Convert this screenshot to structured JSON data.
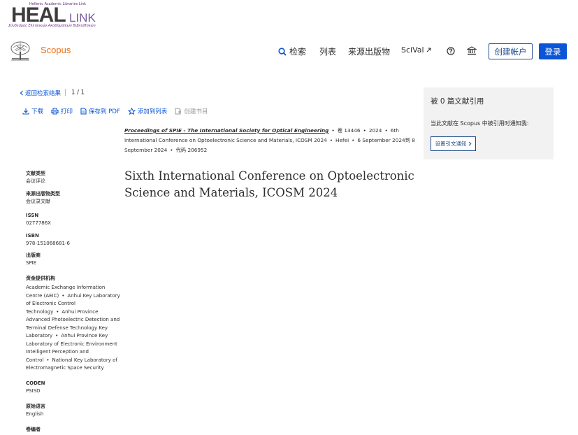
{
  "heal": {
    "top_text": "Hellenic Academic Libraries Link",
    "main": "HEAL",
    "link": "LINK",
    "subtitle": "Σύνδεσμος Ελληνικών Ακαδημαϊκών Βιβλιοθηκών"
  },
  "header": {
    "brand": "Scopus",
    "nav": {
      "search": "检索",
      "list": "列表",
      "sources": "来源出版物",
      "scival": "SciVal"
    },
    "create_account": "创建帐户",
    "login": "登录"
  },
  "breadcrumb": {
    "back": "返回检索结果",
    "pager": "1 / 1"
  },
  "toolbar": {
    "download": "下载",
    "print": "打印",
    "save_pdf": "保存到 PDF",
    "add_list": "添加到列表",
    "create_bib": "创建书目"
  },
  "citations": {
    "title": "被 0 篇文献引用",
    "note": "当此文献在 Scopus 中被引用时通知我:",
    "button": "设置引文通知"
  },
  "source": {
    "journal": "Proceedings of SPIE - The International Society for Optical Engineering",
    "volume": "卷 13446",
    "year": "2024",
    "conference": "6th International Conference on Optoelectronic Science and Materials, ICOSM 2024",
    "location": "Hefei",
    "dates": "6 September 2024到 8 September 2024",
    "code": "代码 206952"
  },
  "document": {
    "title": "Sixth International Conference on Optoelectronic Science and Materials, ICOSM 2024"
  },
  "meta": {
    "doc_type_label": "文献类型",
    "doc_type": "会议评论",
    "source_type_label": "来源出版物类型",
    "source_type": "会议录文献",
    "issn_label": "ISSN",
    "issn": "0277786X",
    "isbn_label": "ISBN",
    "isbn": "978-151068681-6",
    "publisher_label": "出版商",
    "publisher": "SPIE",
    "funding_label": "资金提供机构",
    "funding": [
      "Academic Exchange Information Centre (AEIC)",
      "Anhui Key Laboratory of Electronic Control Technology",
      "Anhui Province Advanced Photoelectric Detection and Terminal Defense Technology Key Laboratory",
      "Anhui Province Key Laboratory of Electronic Environment Intelligent Perception and Control",
      "National Key Laboratory of Electromagnetic Space Security"
    ],
    "coden_label": "CODEN",
    "coden": "PSISD",
    "language_label": "原始语言",
    "language": "English",
    "editors_label": "卷编者"
  },
  "colors": {
    "accent_blue": "#0b55d6",
    "navy": "#1e4b8c",
    "scopus_orange": "#e9711c",
    "panel_gray": "#f2f2f2"
  }
}
